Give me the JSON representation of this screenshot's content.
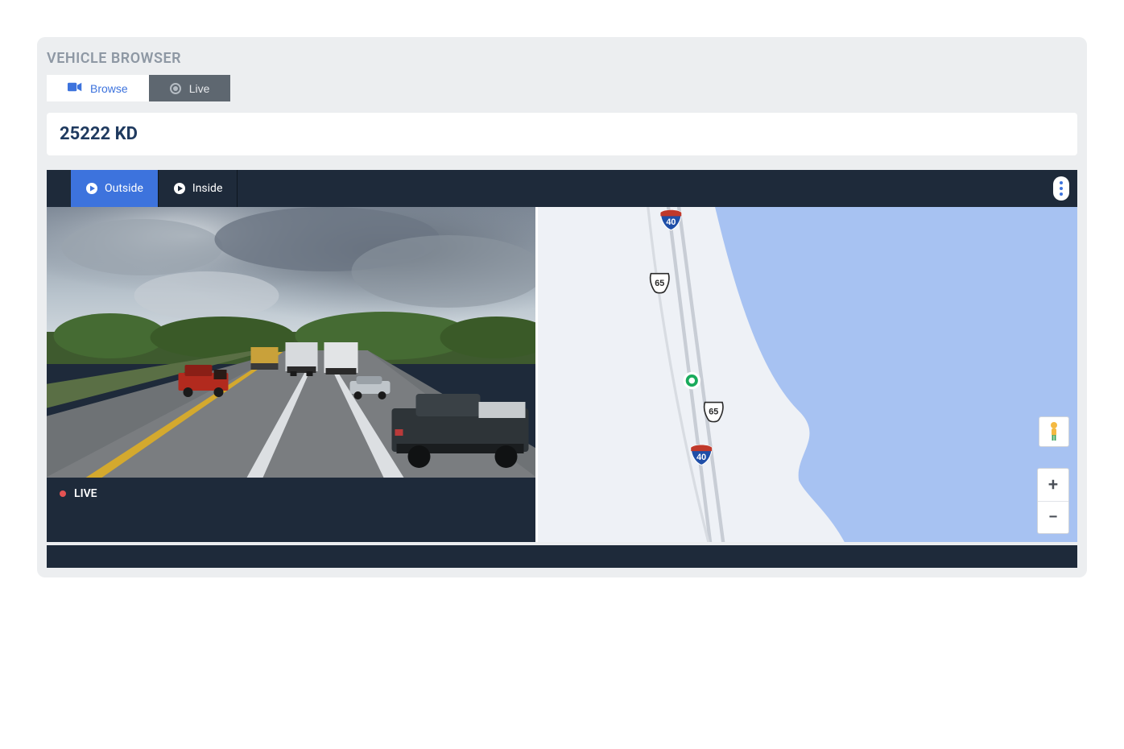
{
  "panel": {
    "title": "VEHICLE BROWSER"
  },
  "mode_tabs": {
    "browse": {
      "label": "Browse",
      "active": true
    },
    "live": {
      "label": "Live",
      "active": false
    }
  },
  "vehicle": {
    "id": "25222 KD"
  },
  "view_tabs": {
    "outside": {
      "label": "Outside",
      "active": true
    },
    "inside": {
      "label": "Inside",
      "active": false
    }
  },
  "live_indicator": {
    "label": "LIVE"
  },
  "map": {
    "route_shields": [
      {
        "number": "40",
        "type": "interstate"
      },
      {
        "number": "65",
        "type": "us"
      },
      {
        "number": "65",
        "type": "us"
      },
      {
        "number": "40",
        "type": "interstate"
      }
    ],
    "zoom_in": "+",
    "zoom_out": "−"
  }
}
